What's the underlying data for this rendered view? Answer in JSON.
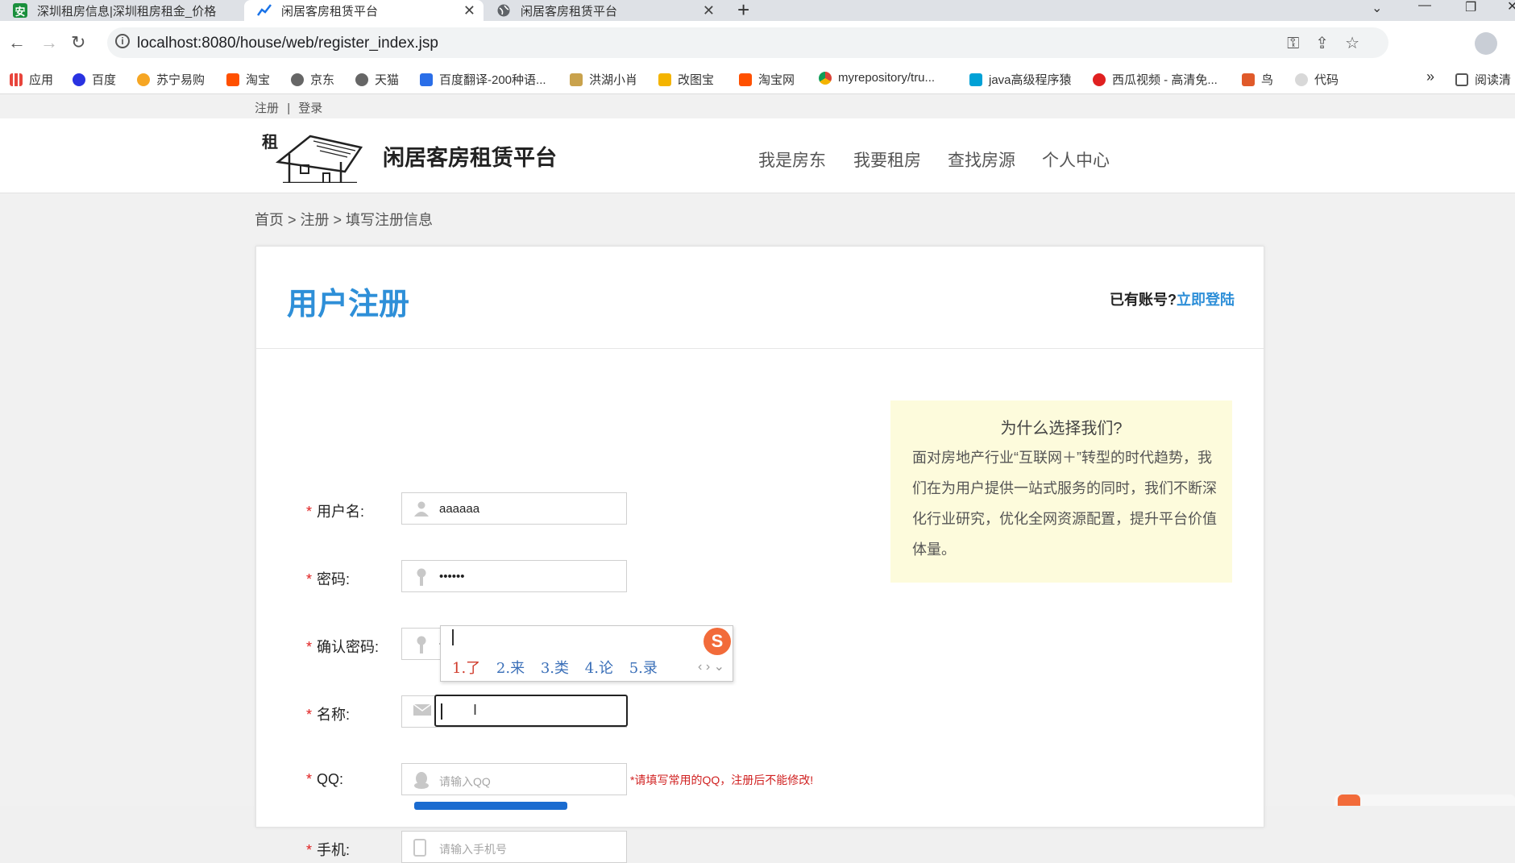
{
  "browser": {
    "tabs": [
      {
        "title": "深圳租房信息|深圳租房租金_价格",
        "favicon": "安",
        "favicon_color": "#1a8f3c"
      },
      {
        "title": "闲居客房租赁平台",
        "active": true,
        "favicon_color": "#1a73e8"
      },
      {
        "title": "闲居客房租赁平台",
        "favicon_color": "#5f6368"
      }
    ],
    "new_tab": "+",
    "url": "localhost:8080/house/web/register_index.jsp",
    "bookmarks": [
      {
        "label": "应用",
        "color": "#e8453c"
      },
      {
        "label": "百度",
        "color": "#2932e1"
      },
      {
        "label": "苏宁易购",
        "color": "#f6a623"
      },
      {
        "label": "淘宝",
        "color": "#ff5000"
      },
      {
        "label": "京东",
        "color": "#555555"
      },
      {
        "label": "天猫",
        "color": "#555555"
      },
      {
        "label": "百度翻译-200种语...",
        "color": "#2a6ee8"
      },
      {
        "label": "洪湖小肖",
        "color": "#c9a24c"
      },
      {
        "label": "改图宝",
        "color": "#f4b400"
      },
      {
        "label": "淘宝网",
        "color": "#ff5000"
      },
      {
        "label": "myrepository/tru...",
        "color": "#4a8a3c"
      },
      {
        "label": "java高级程序猿",
        "color": "#00a1d6"
      },
      {
        "label": "西瓜视频 - 高清免...",
        "color": "#e02020"
      },
      {
        "label": "鸟",
        "color": "#e05a2a"
      },
      {
        "label": "代码",
        "color": "#c8c8c8"
      }
    ],
    "bookmarks_more": "»",
    "reading_list": "阅读清"
  },
  "site": {
    "top_links": {
      "register": "注册",
      "sep": "|",
      "login": "登录"
    },
    "logo_text": "租",
    "name": "闲居客房租赁平台",
    "nav": [
      "我是房东",
      "我要租房",
      "查找房源",
      "个人中心"
    ]
  },
  "breadcrumb": "首页 > 注册 > 填写注册信息",
  "form": {
    "title": "用户注册",
    "has_account": "已有账号?",
    "login_now": "立即登陆",
    "fields": [
      {
        "label": "用户名:",
        "value": "aaaaaa",
        "icon": "user-icon"
      },
      {
        "label": "密码:",
        "value": "••••••",
        "icon": "key-icon"
      },
      {
        "label": "确认密码:",
        "value": "••••••",
        "icon": "key-icon"
      },
      {
        "label": "名称:",
        "value": "",
        "icon": "envelope-icon"
      },
      {
        "label": "QQ:",
        "placeholder": "请输入QQ",
        "hint": "*请填写常用的QQ，注册后不能修改!",
        "icon": "qq-icon"
      },
      {
        "label": "手机:",
        "placeholder": "请输入手机号",
        "icon": "phone-icon"
      }
    ],
    "required_mark": "*"
  },
  "why": {
    "title": "为什么选择我们?",
    "body": "面对房地产行业“互联网＋”转型的时代趋势，我们在为用户提供一站式服务的同时，我们不断深化行业研究，优化全网资源配置，提升平台价值体量。"
  },
  "ime": {
    "candidates": [
      "1.了",
      "2.来",
      "3.类",
      "4.论",
      "5.录"
    ],
    "logo": "S"
  }
}
